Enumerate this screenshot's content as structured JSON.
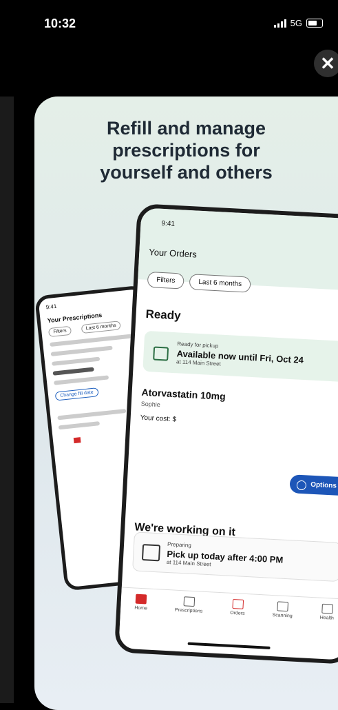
{
  "status": {
    "time": "10:32",
    "network": "5G"
  },
  "onboarding": {
    "headline": "Refill and manage\nprescriptions for\nyourself and others"
  },
  "back_phone": {
    "time": "9:41",
    "title": "Your Prescriptions",
    "chip_filters": "Filters",
    "chip_last": "Last 6 months",
    "blue_button": "Change fill date"
  },
  "front_phone": {
    "time": "9:41",
    "orders_title": "Your Orders",
    "filters_chip": "Filters",
    "months_chip": "Last 6 months",
    "ready_heading": "Ready",
    "pickup_label": "Ready for pickup",
    "pickup_status": "Available now until Fri, Oct 24",
    "pickup_location": "at 114 Main Street",
    "medication_name": "Atorvastatin 10mg",
    "patient_name": "Sophie",
    "cost_label": "Your cost: $",
    "options_button": "Options",
    "working_heading": "We're working on it",
    "preparing_label": "Preparing",
    "preparing_status": "Pick up today after 4:00 PM",
    "preparing_location": "at 114 Main Street",
    "nav": [
      "Home",
      "Prescriptions",
      "Orders",
      "Scanning",
      "Health"
    ]
  },
  "colors": {
    "accent_blue": "#1d56b8",
    "brand_red": "#d42a2a",
    "pickup_green": "#e6f3ea"
  }
}
